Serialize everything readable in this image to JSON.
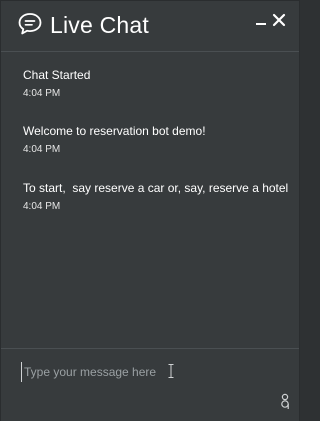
{
  "header": {
    "title": "Live Chat",
    "icons": {
      "chat": "speech-bubble-icon",
      "minimize": "minimize-icon",
      "close": "close-icon"
    }
  },
  "messages": [
    {
      "text": "Chat Started",
      "time": "4:04 PM"
    },
    {
      "text": "Welcome to reservation bot demo!",
      "time": "4:04 PM"
    },
    {
      "text": "To start,  say reserve a car or, say, reserve a hotel",
      "time": "4:04 PM"
    }
  ],
  "composer": {
    "placeholder": "Type your message here",
    "value": ""
  },
  "colors": {
    "background": "#373b3d",
    "divider": "#4a4f52",
    "text": "#ffffff",
    "placeholder": "#9aa0a3"
  }
}
